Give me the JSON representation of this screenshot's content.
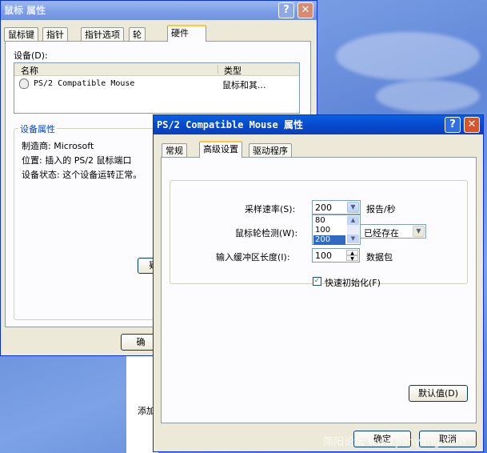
{
  "back_window": {
    "title": "鼠标 属性",
    "tabs": [
      "鼠标键",
      "指针",
      "指针选项",
      "轮",
      "硬件"
    ],
    "devices_label": "设备(D):",
    "columns": [
      "名称",
      "类型"
    ],
    "device_row": {
      "name": "PS/2 Compatible Mouse",
      "type": "鼠标和其..."
    },
    "props_header": "设备属性",
    "manufacturer": "制造商: Microsoft",
    "location": "位置: 插入的 PS/2 鼠标端口",
    "status": "设备状态: 这个设备运转正常。",
    "troubleshoot_partial": "疑",
    "ok_partial": "确",
    "taskbar_item_partial": "添加"
  },
  "front_window": {
    "title": "PS/2 Compatible Mouse 属性",
    "tabs": [
      "常规",
      "高级设置",
      "驱动程序"
    ],
    "sample_rate_label": "采样速率(S):",
    "sample_rate_value": "200",
    "sample_rate_unit": "报告/秒",
    "sample_rate_options": [
      "80",
      "100",
      "200"
    ],
    "wheel_detect_label": "鼠标轮检测(W):",
    "wheel_detect_value": "已经存在",
    "buffer_label": "输入缓冲区长度(I):",
    "buffer_value": "100",
    "buffer_unit": "数据包",
    "fast_init_label": "快速初始化(F)",
    "fast_init_checked": true,
    "defaults_button": "默认值(D)",
    "ok_button": "确定",
    "cancel_button": "取消"
  },
  "watermark": "简阳论坛 www.jianyang.com"
}
